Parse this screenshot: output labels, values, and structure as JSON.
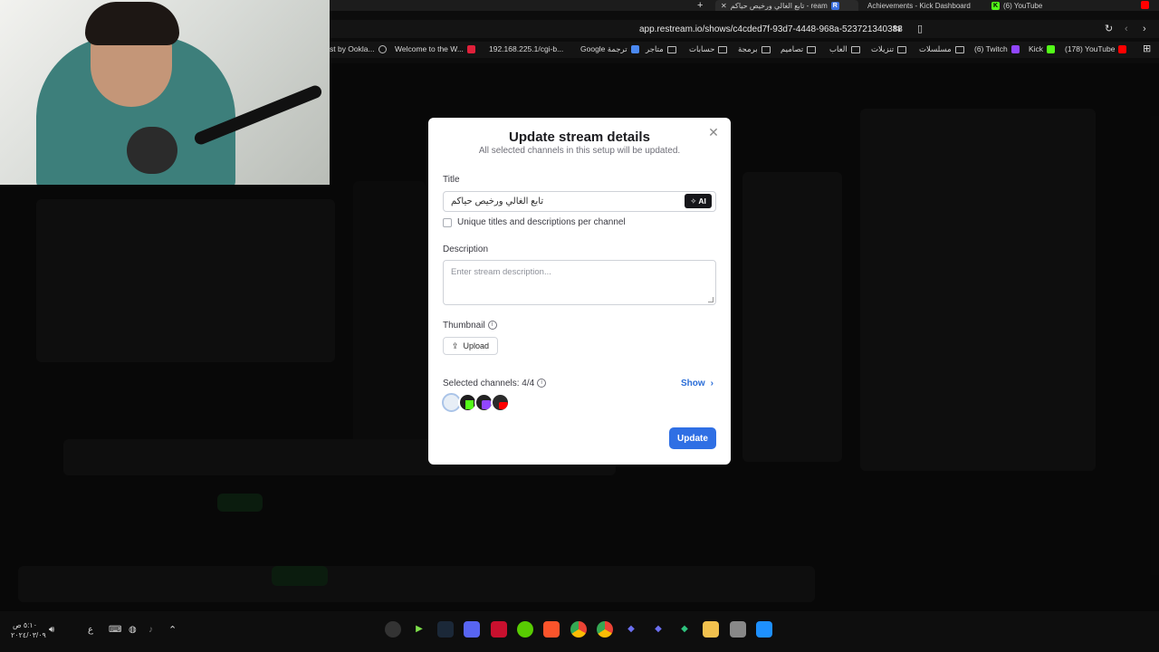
{
  "browser": {
    "tabs": [
      {
        "label": "تابع الغالي ورخيص حياكم - ream",
        "favicon": "R",
        "active": true
      },
      {
        "label": "Achievements - Kick Dashboard",
        "favicon": "K",
        "active": false
      },
      {
        "label": "(6) YouTube",
        "favicon": "",
        "active": false
      }
    ],
    "url": "app.restream.io/shows/c4cded7f-93d7-4448-968a-523721340388",
    "bookmarks": [
      {
        "label": "st by Ookla...",
        "type": "site"
      },
      {
        "label": "Welcome to the W...",
        "type": "site"
      },
      {
        "label": "192.168.225.1/cgi-b...",
        "type": "site"
      },
      {
        "label": "Google ترجمة",
        "type": "site"
      },
      {
        "label": "متاجر",
        "type": "folder"
      },
      {
        "label": "حسابات",
        "type": "folder"
      },
      {
        "label": "برمجة",
        "type": "folder"
      },
      {
        "label": "تصاميم",
        "type": "folder"
      },
      {
        "label": "العاب",
        "type": "folder"
      },
      {
        "label": "تنزيلات",
        "type": "folder"
      },
      {
        "label": "مسلسلات",
        "type": "folder"
      },
      {
        "label": "(6) Twitch",
        "type": "site"
      },
      {
        "label": "Kick",
        "type": "site"
      },
      {
        "label": "(178) YouTube",
        "type": "site"
      }
    ]
  },
  "modal": {
    "title": "Update stream details",
    "subtitle": "All selected channels in this setup will be updated.",
    "title_label": "Title",
    "title_value": "تابع الغالي ورخيص حياكم",
    "ai_label": "AI",
    "unique_label": "Unique titles and descriptions per channel",
    "description_label": "Description",
    "description_placeholder": "Enter stream description...",
    "thumbnail_label": "Thumbnail",
    "upload_label": "Upload",
    "selected_channels_label": "Selected channels: 4/4",
    "show_label": "Show",
    "update_label": "Update",
    "channels": [
      "restream",
      "kick",
      "twitch",
      "youtube"
    ]
  },
  "taskbar": {
    "time": "٥:١٠ ص",
    "date": "٢٠٢٤/٠٣/٠٩",
    "lang": "ع"
  },
  "colors": {
    "accent": "#2f6fe4",
    "kick_green": "#53fc18",
    "twitch_purple": "#9146ff",
    "youtube_red": "#ff0000"
  }
}
